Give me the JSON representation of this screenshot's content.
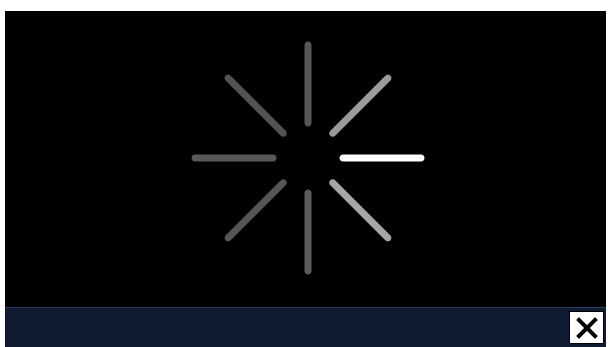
{
  "window": {
    "background": "#000000"
  },
  "loading": {
    "spinner_icon": "loading-spinner-icon",
    "spokes": [
      {
        "name": "spinner-spoke-right",
        "color": "#ffffff"
      },
      {
        "name": "spinner-spoke-lower-right",
        "color": "#a6a6a6"
      },
      {
        "name": "spinner-spoke-bottom",
        "color": "#5c5c5c"
      },
      {
        "name": "spinner-spoke-lower-left",
        "color": "#555555"
      },
      {
        "name": "spinner-spoke-left",
        "color": "#585858"
      },
      {
        "name": "spinner-spoke-upper-left",
        "color": "#525252"
      },
      {
        "name": "spinner-spoke-top",
        "color": "#575757"
      },
      {
        "name": "spinner-spoke-upper-right",
        "color": "#9a9a9a"
      }
    ]
  },
  "bottom_bar": {
    "background": "#0f1b30",
    "close_icon": "close-icon"
  }
}
